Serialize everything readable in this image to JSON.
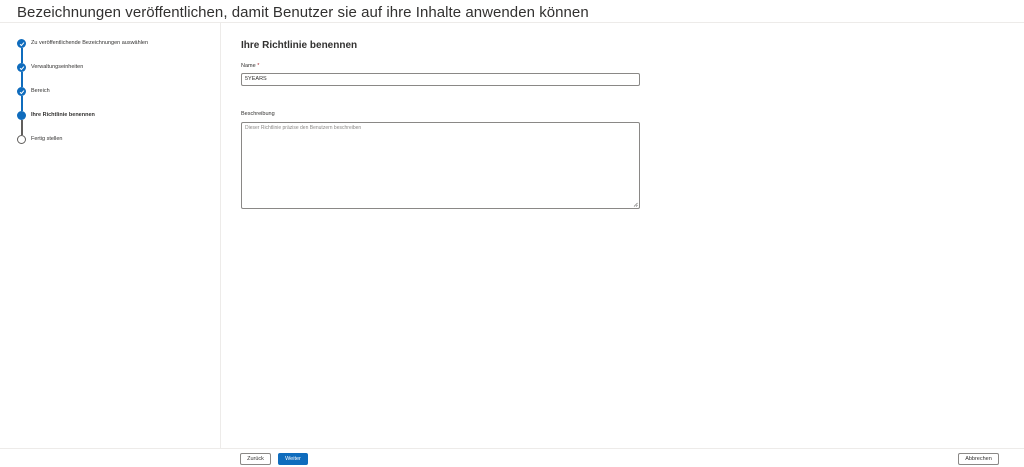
{
  "header": {
    "title": "Bezeichnungen veröffentlichen, damit Benutzer sie auf ihre Inhalte anwenden können"
  },
  "steps": [
    {
      "label": "Zu veröffentlichende Bezeichnungen auswählen",
      "state": "done"
    },
    {
      "label": "Verwaltungseinheiten",
      "state": "done"
    },
    {
      "label": "Bereich",
      "state": "done"
    },
    {
      "label": "Ihre Richtlinie benennen",
      "state": "current"
    },
    {
      "label": "Fertig stellen",
      "state": "todo"
    }
  ],
  "form": {
    "title": "Ihre Richtlinie benennen",
    "name_label": "Name",
    "required_mark": "*",
    "name_value": "5YEARS",
    "description_label": "Beschreibung",
    "description_placeholder": "Dieser Richtlinie präzise den Benutzern beschreiben"
  },
  "footer": {
    "back_label": "Zurück",
    "next_label": "Weiter",
    "cancel_label": "Abbrechen"
  },
  "colors": {
    "accent": "#0f6cbd",
    "border": "#8a8886",
    "required": "#a4262c"
  }
}
